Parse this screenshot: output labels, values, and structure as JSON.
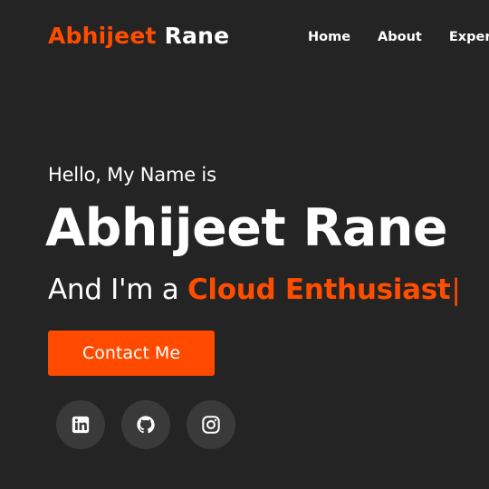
{
  "header": {
    "logo_first": "Abhijeet",
    "logo_last": "Rane",
    "nav": [
      {
        "label": "Home"
      },
      {
        "label": "About"
      },
      {
        "label": "Experience"
      }
    ]
  },
  "hero": {
    "greeting": "Hello, My Name is",
    "name": "Abhijeet Rane",
    "role_prefix": "And I'm a",
    "role_highlight": "Cloud Enthusiast",
    "cursor": "|",
    "contact_label": "Contact Me"
  },
  "social": [
    {
      "icon": "linkedin-icon"
    },
    {
      "icon": "github-icon"
    },
    {
      "icon": "instagram-icon"
    }
  ],
  "colors": {
    "background": "#242424",
    "accent": "#ff4d00",
    "button": "#ff4a00",
    "social_circle": "#3a3a3a",
    "text": "#ffffff"
  }
}
